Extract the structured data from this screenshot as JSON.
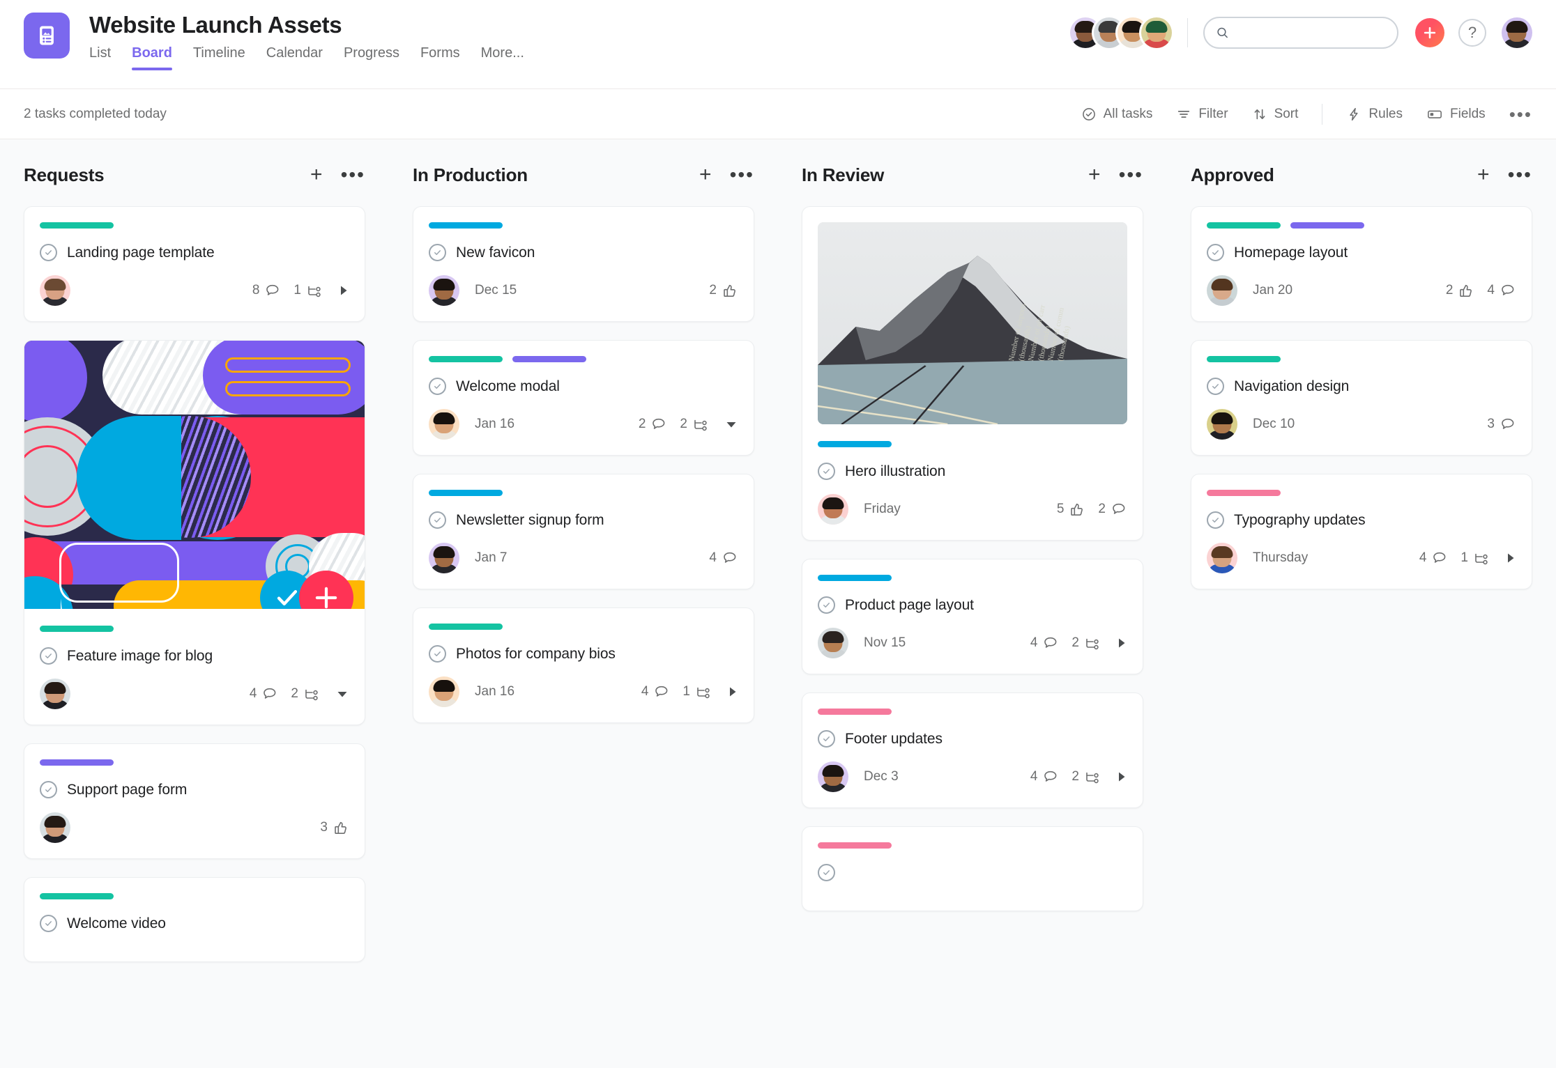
{
  "header": {
    "project_title": "Website Launch Assets",
    "project_icon": "image-list-icon",
    "tabs": [
      {
        "label": "List",
        "active": false
      },
      {
        "label": "Board",
        "active": true
      },
      {
        "label": "Timeline",
        "active": false
      },
      {
        "label": "Calendar",
        "active": false
      },
      {
        "label": "Progress",
        "active": false
      },
      {
        "label": "Forms",
        "active": false
      },
      {
        "label": "More...",
        "active": false
      }
    ],
    "members": [
      {
        "skin": "#8a5a3c",
        "hair": "#241a14",
        "shirt": "#1e1e22",
        "bg": "#ded2f2"
      },
      {
        "skin": "#b98158",
        "hair": "#3a3a3a",
        "shirt": "#c9ced2",
        "bg": "#d5dade"
      },
      {
        "skin": "#c9905f",
        "hair": "#1a1410",
        "shirt": "#e8e2d8",
        "bg": "#fae2c8"
      },
      {
        "skin": "#e0a878",
        "hair": "#1f5c38",
        "shirt": "#d94a4a",
        "bg": "#d9d29a"
      }
    ],
    "search_placeholder": "",
    "search_value": "",
    "add_label": "+",
    "help_label": "?",
    "me": {
      "skin": "#9c6a44",
      "hair": "#211812",
      "shirt": "#26262b",
      "bg": "#cfc0ef"
    }
  },
  "toolbar": {
    "completed_text": "2 tasks completed today",
    "items": [
      {
        "label": "All tasks",
        "icon": "check-circle-icon"
      },
      {
        "label": "Filter",
        "icon": "filter-icon"
      },
      {
        "label": "Sort",
        "icon": "sort-icon"
      },
      {
        "label": "Rules",
        "icon": "lightning-icon"
      },
      {
        "label": "Fields",
        "icon": "fields-icon"
      }
    ],
    "more_label": "•••"
  },
  "columns": [
    {
      "title": "Requests",
      "cards": [
        {
          "title": "Landing page template",
          "tags": [
            "#14c3a2"
          ],
          "assignee": {
            "skin": "#d8a184",
            "hair": "#6b4a33",
            "shirt": "#2a2a30",
            "bg": "#fbd3d3"
          },
          "date": "",
          "meta": [
            {
              "num": "8",
              "icon": "comment-icon"
            },
            {
              "num": "1",
              "icon": "subtask-icon"
            }
          ],
          "trailing": "caret-right"
        },
        {
          "title": "Feature image for blog",
          "artwork": "colorful-collage",
          "tags": [
            "#14c3a2"
          ],
          "assignee": {
            "skin": "#cf9a78",
            "hair": "#241a14",
            "shirt": "#1f1f24",
            "bg": "#d7dfe2"
          },
          "date": "",
          "meta": [
            {
              "num": "4",
              "icon": "comment-icon"
            },
            {
              "num": "2",
              "icon": "subtask-icon"
            }
          ],
          "trailing": "caret-down"
        },
        {
          "title": "Support page form",
          "tags": [
            "#7b68ee"
          ],
          "assignee": {
            "skin": "#cf9a78",
            "hair": "#241a14",
            "shirt": "#1f1f24",
            "bg": "#d7dfe2"
          },
          "date": "",
          "meta": [
            {
              "num": "3",
              "icon": "thumbsup-icon"
            }
          ],
          "trailing": ""
        },
        {
          "title": "Welcome video",
          "tags": [
            "#14c3a2"
          ],
          "assignee": null,
          "date": "",
          "meta": [],
          "trailing": ""
        }
      ]
    },
    {
      "title": "In Production",
      "cards": [
        {
          "title": "New favicon",
          "tags": [
            "#00a9e0"
          ],
          "assignee": {
            "skin": "#a06a43",
            "hair": "#1b1410",
            "shirt": "#25252a",
            "bg": "#d8c8f2"
          },
          "date": "Dec 15",
          "meta": [
            {
              "num": "2",
              "icon": "thumbsup-icon"
            }
          ],
          "trailing": ""
        },
        {
          "title": "Welcome modal",
          "tags": [
            "#14c3a2",
            "#7b68ee"
          ],
          "assignee": {
            "skin": "#d9a277",
            "hair": "#17110d",
            "shirt": "#ece6dc",
            "bg": "#fbe0c4"
          },
          "date": "Jan 16",
          "meta": [
            {
              "num": "2",
              "icon": "comment-icon"
            },
            {
              "num": "2",
              "icon": "subtask-icon"
            }
          ],
          "trailing": "caret-down"
        },
        {
          "title": "Newsletter signup form",
          "tags": [
            "#00a9e0"
          ],
          "assignee": {
            "skin": "#a06a43",
            "hair": "#1b1410",
            "shirt": "#25252a",
            "bg": "#d8c8f2"
          },
          "date": "Jan 7",
          "meta": [
            {
              "num": "4",
              "icon": "comment-icon"
            }
          ],
          "trailing": ""
        },
        {
          "title": "Photos for company bios",
          "tags": [
            "#14c3a2"
          ],
          "assignee": {
            "skin": "#d9a277",
            "hair": "#17110d",
            "shirt": "#ece6dc",
            "bg": "#fbe0c4"
          },
          "date": "Jan 16",
          "meta": [
            {
              "num": "4",
              "icon": "comment-icon"
            },
            {
              "num": "1",
              "icon": "subtask-icon"
            }
          ],
          "trailing": "caret-right"
        }
      ]
    },
    {
      "title": "In Review",
      "cards": [
        {
          "title": "Hero illustration",
          "artwork": "mountain-photo",
          "tags": [
            "#00a9e0"
          ],
          "assignee": {
            "skin": "#c07a55",
            "hair": "#1c1512",
            "shirt": "#e6e9ea",
            "bg": "#fbd1d1"
          },
          "date": "Friday",
          "meta": [
            {
              "num": "5",
              "icon": "thumbsup-icon"
            },
            {
              "num": "2",
              "icon": "comment-icon"
            }
          ],
          "trailing": ""
        },
        {
          "title": "Product page layout",
          "tags": [
            "#00a9e0"
          ],
          "assignee": {
            "skin": "#b77f52",
            "hair": "#2a2320",
            "shirt": "#cfd4d6",
            "bg": "#d6dcde"
          },
          "date": "Nov 15",
          "meta": [
            {
              "num": "4",
              "icon": "comment-icon"
            },
            {
              "num": "2",
              "icon": "subtask-icon"
            }
          ],
          "trailing": "caret-right"
        },
        {
          "title": "Footer updates",
          "tags": [
            "#f5799c"
          ],
          "assignee": {
            "skin": "#a06a43",
            "hair": "#1b1410",
            "shirt": "#25252a",
            "bg": "#d8c8f2"
          },
          "date": "Dec 3",
          "meta": [
            {
              "num": "4",
              "icon": "comment-icon"
            },
            {
              "num": "2",
              "icon": "subtask-icon"
            }
          ],
          "trailing": "caret-right"
        },
        {
          "title": "",
          "tags": [
            "#f5799c"
          ],
          "assignee": null,
          "date": "",
          "meta": [],
          "trailing": ""
        }
      ]
    },
    {
      "title": "Approved",
      "cards": [
        {
          "title": "Homepage layout",
          "tags": [
            "#14c3a2",
            "#7b68ee"
          ],
          "assignee": {
            "skin": "#d8a98a",
            "hair": "#53351f",
            "shirt": "#c5ccd0",
            "bg": "#ccd7d8"
          },
          "date": "Jan 20",
          "meta": [
            {
              "num": "2",
              "icon": "thumbsup-icon"
            },
            {
              "num": "4",
              "icon": "comment-icon"
            }
          ],
          "trailing": ""
        },
        {
          "title": "Navigation design",
          "tags": [
            "#14c3a2"
          ],
          "assignee": {
            "skin": "#b07a4c",
            "hair": "#19130e",
            "shirt": "#1f1f24",
            "bg": "#d9d08a"
          },
          "date": "Dec 10",
          "meta": [
            {
              "num": "3",
              "icon": "comment-icon"
            }
          ],
          "trailing": ""
        },
        {
          "title": "Typography updates",
          "tags": [
            "#f5799c"
          ],
          "assignee": {
            "skin": "#d5a380",
            "hair": "#593a22",
            "shirt": "#2a58b8",
            "bg": "#fbd3d3"
          },
          "date": "Thursday",
          "meta": [
            {
              "num": "4",
              "icon": "comment-icon"
            },
            {
              "num": "1",
              "icon": "subtask-icon"
            }
          ],
          "trailing": "caret-right"
        }
      ]
    }
  ],
  "artwork": {
    "mountain_texts": [
      "Number of airports",
      "(thousands)",
      "Number of air carr",
      "(thousands)",
      "Number of comm",
      "(thousands)"
    ]
  },
  "colors": {
    "brand_purple": "#7b68ee",
    "accent_pink": "#ff5263",
    "green_tag": "#14c3a2",
    "blue_tag": "#00a9e0",
    "pink_tag": "#f5799c",
    "text_dark": "#1e1f21",
    "text_muted": "#6d6e6f",
    "board_bg": "#f9fafb"
  }
}
